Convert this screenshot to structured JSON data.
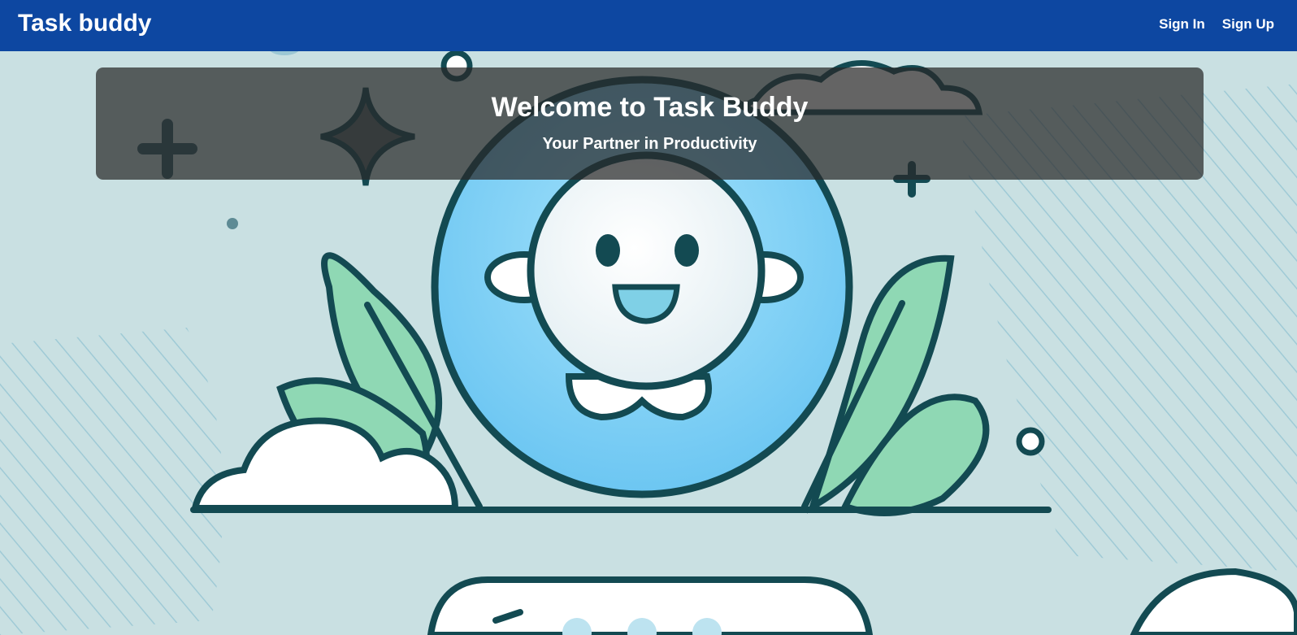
{
  "navbar": {
    "brand": "Task buddy",
    "links": {
      "sign_in": "Sign In",
      "sign_up": "Sign Up"
    }
  },
  "hero": {
    "title": "Welcome to Task Buddy",
    "subtitle": "Your Partner in Productivity",
    "illustration": "smiling-buddy-mascot-illustration"
  },
  "colors": {
    "navbar_bg": "#0d47a1",
    "text": "#ffffff",
    "background": "#c9e0e2",
    "mascot_body": "#7fcff5",
    "leaf": "#8fd8b4",
    "outline": "#134a52",
    "banner_overlay": "rgba(40,40,40,0.72)"
  }
}
